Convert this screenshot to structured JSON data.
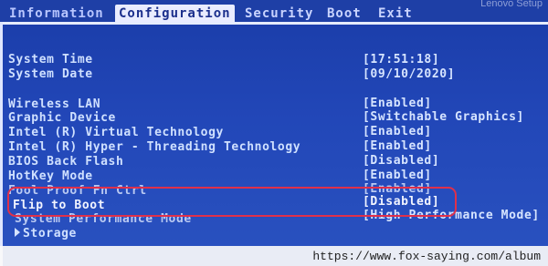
{
  "menu": {
    "tabs": [
      "Information",
      "Configuration",
      "Security",
      "Boot",
      "Exit"
    ],
    "active": "Configuration",
    "brand": "Lenovo Setup"
  },
  "settings": [
    {
      "label": "System Time",
      "value": "[17:51:18]"
    },
    {
      "label": "System Date",
      "value": "[09/10/2020]"
    },
    {
      "label": "Wireless LAN",
      "value": "[Enabled]"
    },
    {
      "label": "Graphic Device",
      "value": "[Switchable Graphics]"
    },
    {
      "label": "Intel (R) Virtual Technology",
      "value": "[Enabled]"
    },
    {
      "label": "Intel (R) Hyper - Threading Technology",
      "value": "[Enabled]"
    },
    {
      "label": "BIOS Back Flash",
      "value": "[Disabled]"
    },
    {
      "label": "HotKey Mode",
      "value": "[Enabled]"
    },
    {
      "label": "Fool Proof Fn Ctrl",
      "value": "[Enabled]"
    },
    {
      "label": "Flip to Boot",
      "value": "[Disabled]"
    },
    {
      "label": "System Performance Mode",
      "value": "[High Performance Mode]"
    }
  ],
  "submenu": {
    "label": "Storage"
  },
  "highlight_color": "#e0304a",
  "watermark": "https://www.fox-saying.com/album"
}
